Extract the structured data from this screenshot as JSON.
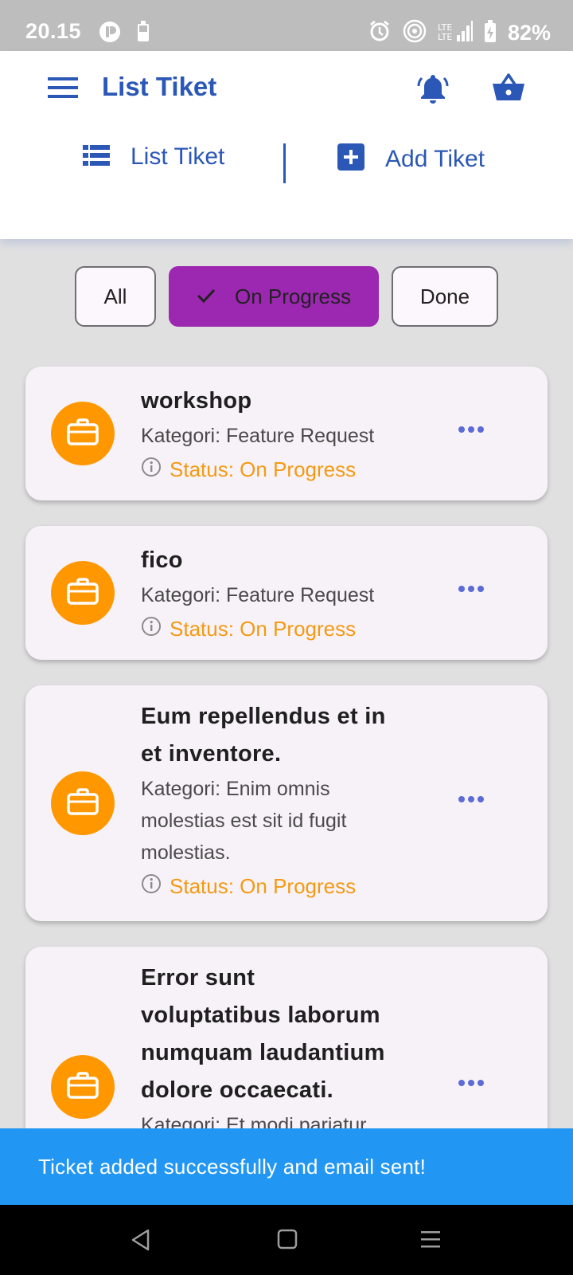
{
  "status_bar": {
    "time": "20.15",
    "battery": "82%"
  },
  "header": {
    "title": "List Tiket",
    "tabs": [
      {
        "label": "List Tiket",
        "icon": "list-icon"
      },
      {
        "label": "Add Tiket",
        "icon": "add-box-icon"
      }
    ]
  },
  "filters": {
    "all": "All",
    "on_progress": "On Progress",
    "done": "Done",
    "selected": "On Progress"
  },
  "tickets": [
    {
      "title_lines": [
        "workshop"
      ],
      "category_lines": [
        "Kategori: Feature Request"
      ],
      "status": "Status: On Progress"
    },
    {
      "title_lines": [
        "fico"
      ],
      "category_lines": [
        "Kategori: Feature Request"
      ],
      "status": "Status: On Progress"
    },
    {
      "title_lines": [
        "Eum repellendus et in",
        "et inventore."
      ],
      "category_lines": [
        "Kategori: Enim omnis",
        "molestias est sit id fugit",
        "molestias."
      ],
      "status": "Status: On Progress"
    },
    {
      "title_lines": [
        "Error sunt",
        "voluptatibus laborum",
        "numquam laudantium",
        "dolore occaecati."
      ],
      "category_lines": [
        "Kategori: Et modi pariatur"
      ],
      "status": ""
    }
  ],
  "snackbar": {
    "message": "Ticket added successfully and email sent!"
  },
  "colors": {
    "primary": "#2b57b7",
    "chip_selected": "#9c27b0",
    "avatar": "#ff9800",
    "status_text": "#f49a12",
    "snackbar": "#2196f3",
    "more_dots": "#5c6bd6"
  }
}
